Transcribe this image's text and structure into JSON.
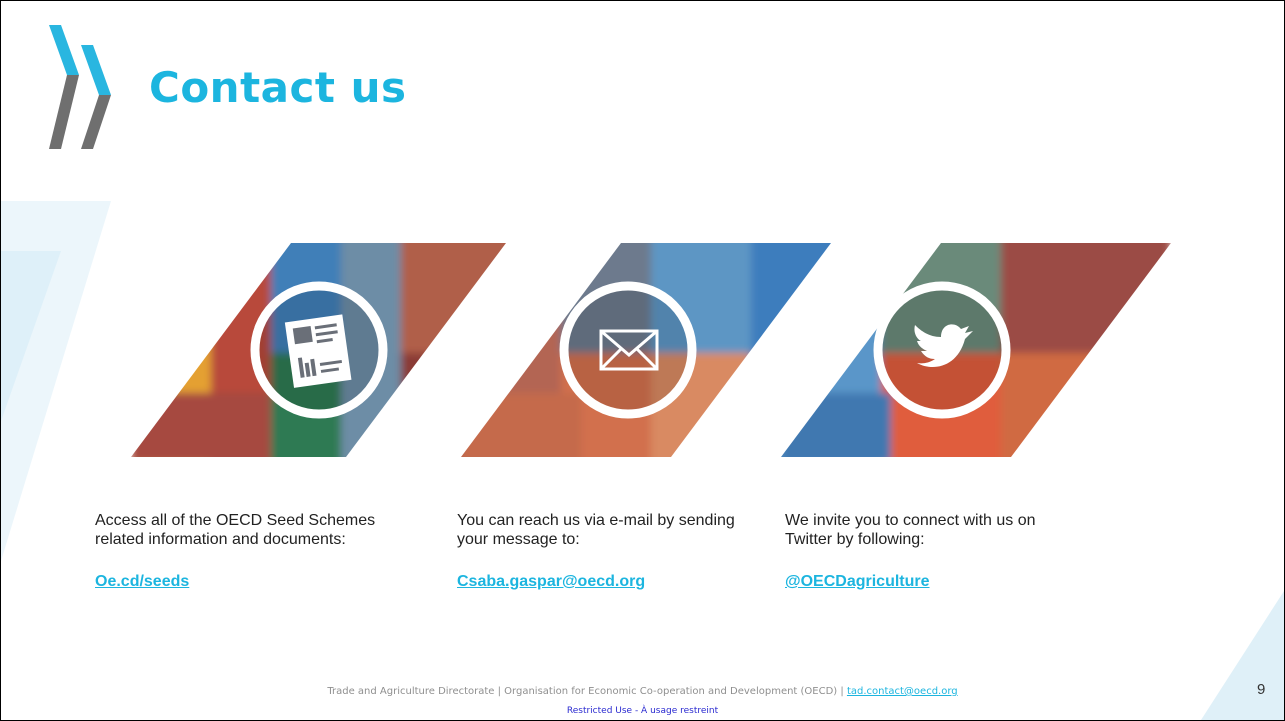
{
  "slide": {
    "title": "Contact us",
    "page_number": "9"
  },
  "icons": [
    "document-chart-icon",
    "envelope-icon",
    "twitter-bird-icon"
  ],
  "colors": {
    "accent": "#1cb5df",
    "logo_blue": "#29b6e0",
    "logo_grey": "#6f6f6f",
    "restricted_text": "#2a2ad0"
  },
  "columns": [
    {
      "text": "Access all of the OECD Seed Schemes related information and documents:",
      "link": "Oe.cd/seeds"
    },
    {
      "text": "You can reach us via e-mail by sending your message to:",
      "link": "Csaba.gaspar@oecd.org"
    },
    {
      "text": "We invite you to connect with us on Twitter by following:",
      "link": "@OECDagriculture"
    }
  ],
  "footer": {
    "text": "Trade and Agriculture Directorate | Organisation for Economic Co-operation and Development (OECD) | ",
    "email": "tad.contact@oecd.org",
    "restricted": "Restricted Use - À usage restreint"
  }
}
